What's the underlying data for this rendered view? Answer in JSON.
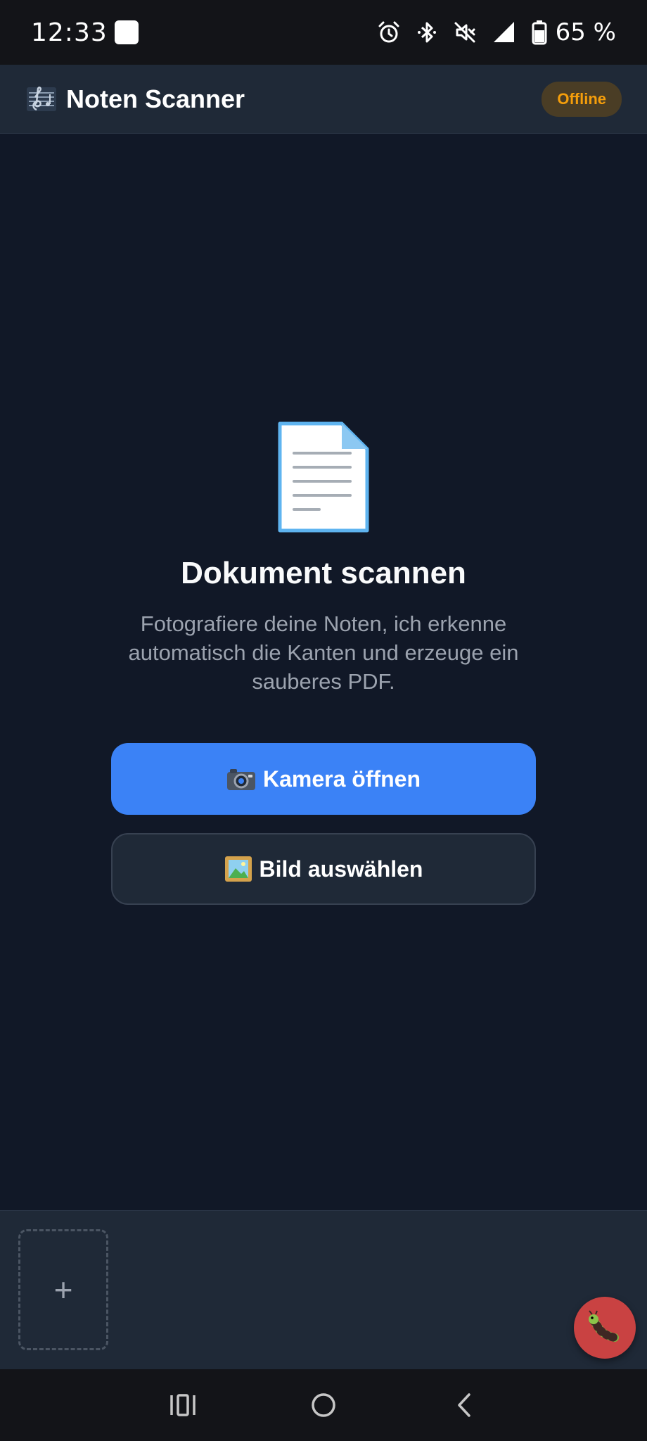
{
  "status_bar": {
    "time": "12:33",
    "battery_percent": "65 %",
    "icons": [
      "alarm-icon",
      "bluetooth-icon",
      "mute-icon",
      "signal-icon",
      "battery-icon"
    ]
  },
  "header": {
    "logo_icon": "music-score-icon",
    "title": "Noten Scanner",
    "status_badge": "Offline"
  },
  "main": {
    "illustration_icon": "document-icon",
    "title": "Dokument scannen",
    "description": "Fotografiere deine Noten, ich erkenne automatisch die Kanten und erzeuge ein sauberes PDF.",
    "camera_button": {
      "icon": "camera-icon",
      "label": "Kamera öffnen"
    },
    "image_button": {
      "icon": "picture-icon",
      "label": "Bild auswählen"
    }
  },
  "tray": {
    "add_page_symbol": "+",
    "bug_button_icon": "bug-icon"
  },
  "colors": {
    "background": "#111827",
    "surface": "#1f2937",
    "accent": "#3b82f6",
    "offline_badge": "#f59e0b",
    "bug_fab": "#c94242"
  },
  "nav_bar": {
    "buttons": [
      "recent-apps-icon",
      "home-icon",
      "back-icon"
    ]
  }
}
